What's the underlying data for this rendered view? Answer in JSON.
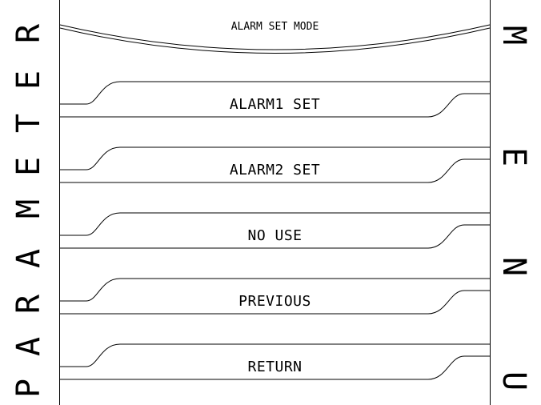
{
  "left_banner": {
    "letters": [
      "P",
      "A",
      "R",
      "A",
      "M",
      "E",
      "T",
      "E",
      "R"
    ]
  },
  "right_banner": {
    "letters": [
      "M",
      "E",
      "N",
      "U"
    ]
  },
  "header": {
    "title": "ALARM SET MODE"
  },
  "menu": {
    "items": [
      {
        "label": "ALARM1 SET"
      },
      {
        "label": "ALARM2 SET"
      },
      {
        "label": "NO USE"
      },
      {
        "label": "PREVIOUS"
      },
      {
        "label": "RETURN"
      }
    ]
  },
  "colors": {
    "foreground": "#000000",
    "background": "#ffffff"
  }
}
